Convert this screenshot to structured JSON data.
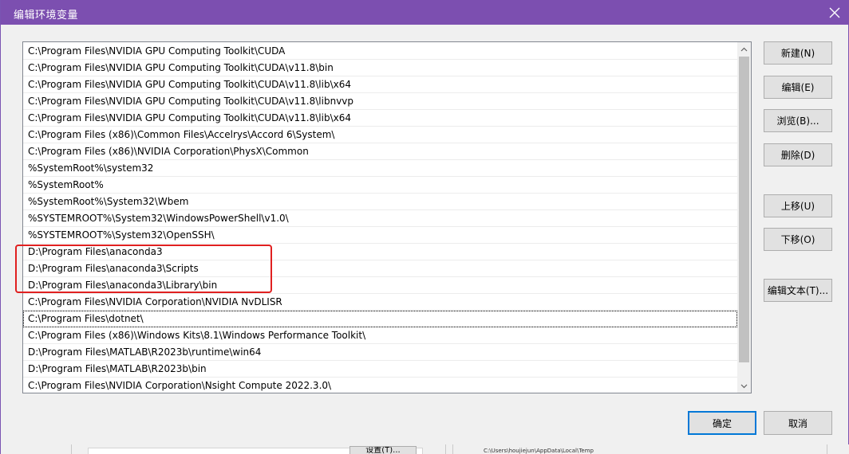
{
  "window": {
    "title": "编辑环境变量",
    "titlebar_color": "#7c4fb0"
  },
  "paths": [
    "C:\\Program Files\\NVIDIA GPU Computing Toolkit\\CUDA",
    "C:\\Program Files\\NVIDIA GPU Computing Toolkit\\CUDA\\v11.8\\bin",
    "C:\\Program Files\\NVIDIA GPU Computing Toolkit\\CUDA\\v11.8\\lib\\x64",
    "C:\\Program Files\\NVIDIA GPU Computing Toolkit\\CUDA\\v11.8\\libnvvp",
    "C:\\Program Files\\NVIDIA GPU Computing Toolkit\\CUDA\\v11.8\\lib\\x64",
    "C:\\Program Files (x86)\\Common Files\\Accelrys\\Accord 6\\System\\",
    "C:\\Program Files (x86)\\NVIDIA Corporation\\PhysX\\Common",
    "%SystemRoot%\\system32",
    "%SystemRoot%",
    "%SystemRoot%\\System32\\Wbem",
    "%SYSTEMROOT%\\System32\\WindowsPowerShell\\v1.0\\",
    "%SYSTEMROOT%\\System32\\OpenSSH\\",
    "D:\\Program Files\\anaconda3",
    "D:\\Program Files\\anaconda3\\Scripts",
    "D:\\Program Files\\anaconda3\\Library\\bin",
    "C:\\Program Files\\NVIDIA Corporation\\NVIDIA NvDLISR",
    "C:\\Program Files\\dotnet\\",
    "C:\\Program Files (x86)\\Windows Kits\\8.1\\Windows Performance Toolkit\\",
    "D:\\Program Files\\MATLAB\\R2023b\\runtime\\win64",
    "D:\\Program Files\\MATLAB\\R2023b\\bin",
    "C:\\Program Files\\NVIDIA Corporation\\Nsight Compute 2022.3.0\\"
  ],
  "focused_index": 16,
  "highlight_color": "#e02020",
  "buttons": {
    "new": "新建(N)",
    "edit": "编辑(E)",
    "browse": "浏览(B)...",
    "delete": "删除(D)",
    "move_up": "上移(U)",
    "move_down": "下移(O)",
    "edit_text": "编辑文本(T)...",
    "ok": "确定",
    "cancel": "取消"
  },
  "background": {
    "button_label": "设置(T)...",
    "path_text": "C:\\Users\\houjiejun\\AppData\\Local\\Temp"
  }
}
